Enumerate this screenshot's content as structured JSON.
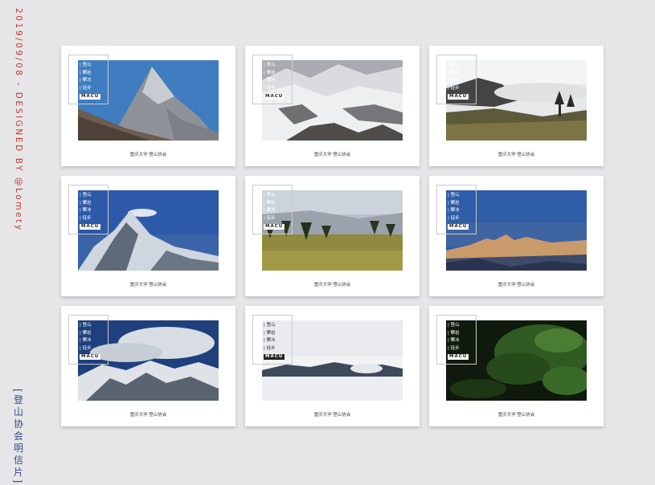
{
  "side_title": "2019/09/08 - DESIGNED BY @Lomety",
  "side_subtitle": "[登山协会明信片]",
  "cards": [
    {
      "tags": [
        "登山",
        "攀岩",
        "攀冰",
        "徒步"
      ],
      "badge": "MACU",
      "caption": "重庆大学·登山协会",
      "photo": "snow-peak-blue-sky"
    },
    {
      "tags": [
        "登山",
        "攀岩",
        "攀冰",
        "徒步"
      ],
      "badge": "MACU",
      "caption": "重庆大学·登山协会",
      "photo": "snowy-ridge-overcast"
    },
    {
      "tags": [
        "登山",
        "攀岩",
        "攀冰",
        "徒步"
      ],
      "badge": "MACU",
      "caption": "重庆大学·登山协会",
      "photo": "cloud-sea-forest"
    },
    {
      "tags": [
        "登山",
        "攀岩",
        "攀冰",
        "徒步"
      ],
      "badge": "MACU",
      "caption": "重庆大学·登山协会",
      "photo": "snow-peak-cloud"
    },
    {
      "tags": [
        "登山",
        "攀岩",
        "攀冰",
        "徒步"
      ],
      "badge": "MACU",
      "caption": "重庆大学·登山协会",
      "photo": "alpine-meadow-forest"
    },
    {
      "tags": [
        "登山",
        "攀岩",
        "攀冰",
        "徒步"
      ],
      "badge": "MACU",
      "caption": "重庆大学·登山协会",
      "photo": "sunset-snow-range"
    },
    {
      "tags": [
        "登山",
        "攀岩",
        "攀冰",
        "徒步"
      ],
      "badge": "MACU",
      "caption": "重庆大学·登山协会",
      "photo": "snow-range-clouds"
    },
    {
      "tags": [
        "登山",
        "攀岩",
        "攀冰",
        "徒步"
      ],
      "badge": "MACU",
      "caption": "重庆大学·登山协会",
      "photo": "cloud-sea-ridge"
    },
    {
      "tags": [
        "登山",
        "攀岩",
        "攀冰",
        "徒步"
      ],
      "badge": "MACU",
      "caption": "重庆大学·登山协会",
      "photo": "green-forest-ferns"
    }
  ]
}
